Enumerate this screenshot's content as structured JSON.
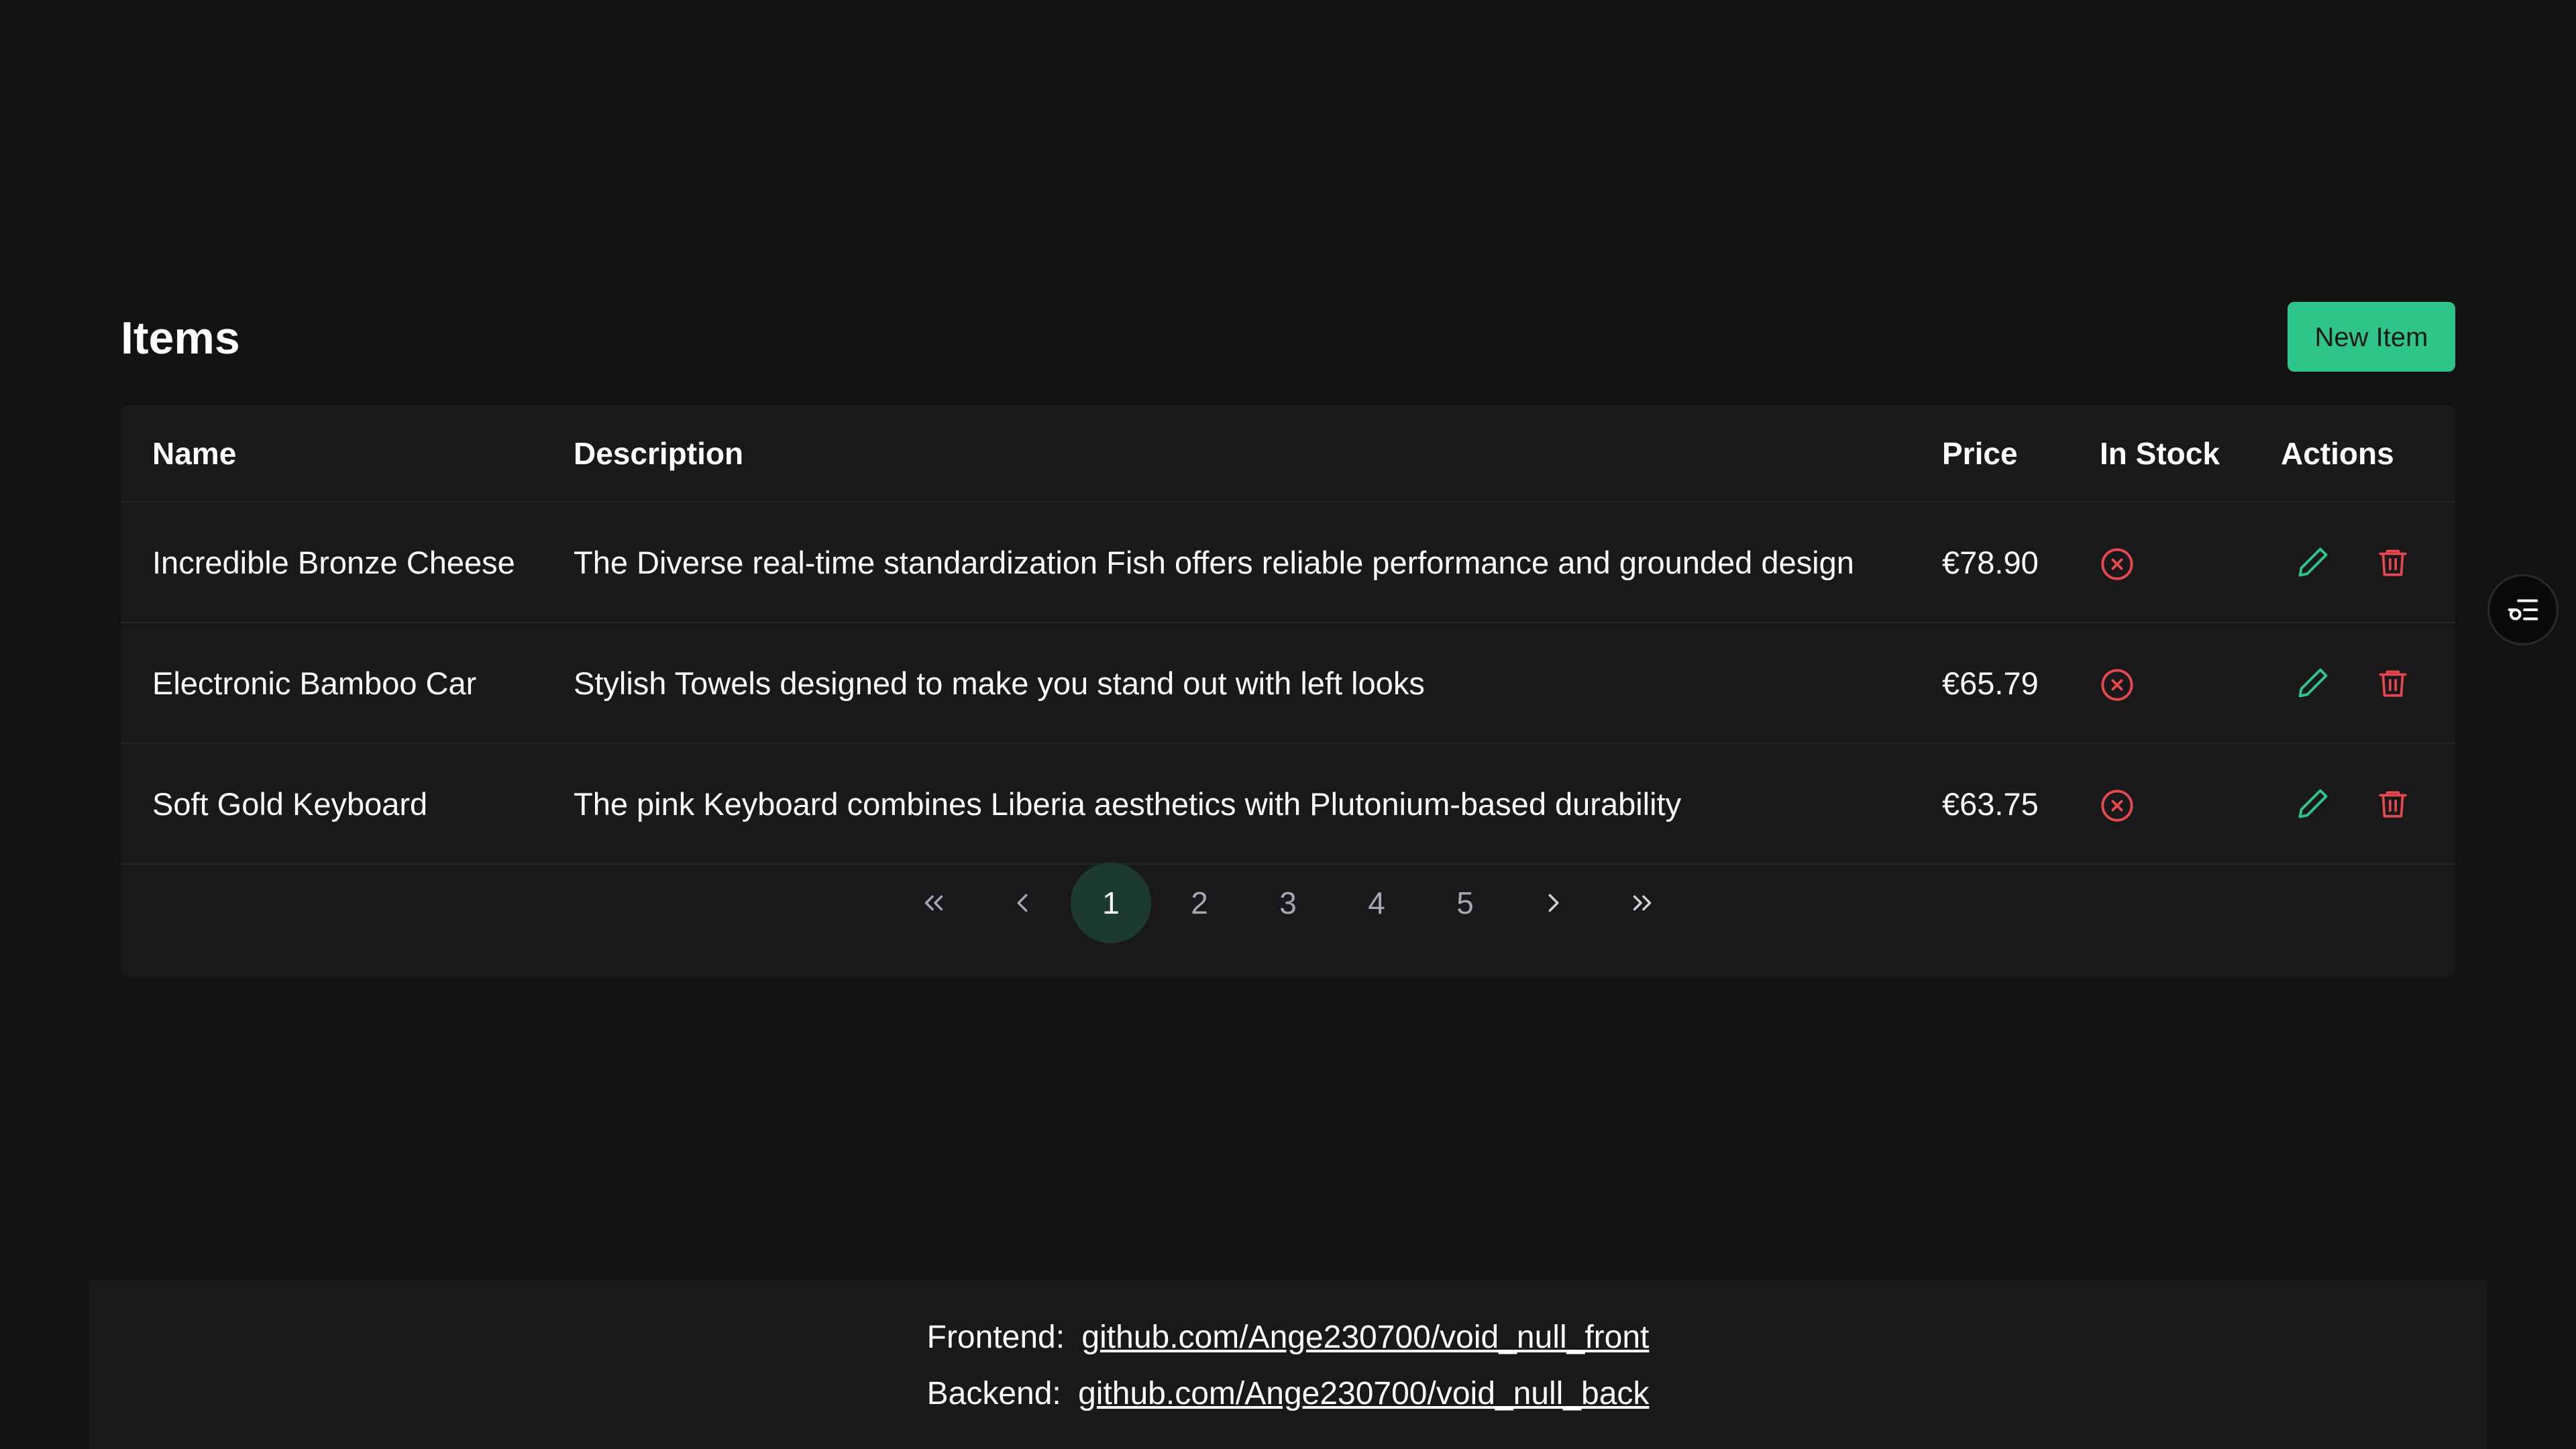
{
  "header": {
    "title": "Items",
    "new_button_label": "New Item"
  },
  "table": {
    "columns": [
      "Name",
      "Description",
      "Price",
      "In Stock",
      "Actions"
    ],
    "rows": [
      {
        "name": "Incredible Bronze Cheese",
        "description": "The Diverse real-time standardization Fish offers reliable performance and grounded design",
        "price": "€78.90",
        "in_stock": false
      },
      {
        "name": "Electronic Bamboo Car",
        "description": "Stylish Towels designed to make you stand out with left looks",
        "price": "€65.79",
        "in_stock": false
      },
      {
        "name": "Soft Gold Keyboard",
        "description": "The pink Keyboard combines Liberia aesthetics with Plutonium-based durability",
        "price": "€63.75",
        "in_stock": false
      }
    ]
  },
  "pagination": {
    "current_page": 1,
    "pages": [
      "1",
      "2",
      "3",
      "4",
      "5"
    ],
    "first_icon": "chevrons-left-icon",
    "prev_icon": "chevron-left-icon",
    "next_icon": "chevron-right-icon",
    "last_icon": "chevrons-right-icon"
  },
  "icons": {
    "stock": "x-circle-icon",
    "edit": "pencil-icon",
    "delete": "trash-icon",
    "floating": "settings-list-icon"
  },
  "footer": {
    "frontend_label": "Frontend:",
    "frontend_link": "github.com/Ange230700/void_null_front",
    "backend_label": "Backend:",
    "backend_link": "github.com/Ange230700/void_null_back"
  },
  "colors": {
    "background": "#121214",
    "surface": "#19191c",
    "accent": "#2ec48a",
    "danger": "#e5484d",
    "active_page": "#1d3a30"
  }
}
